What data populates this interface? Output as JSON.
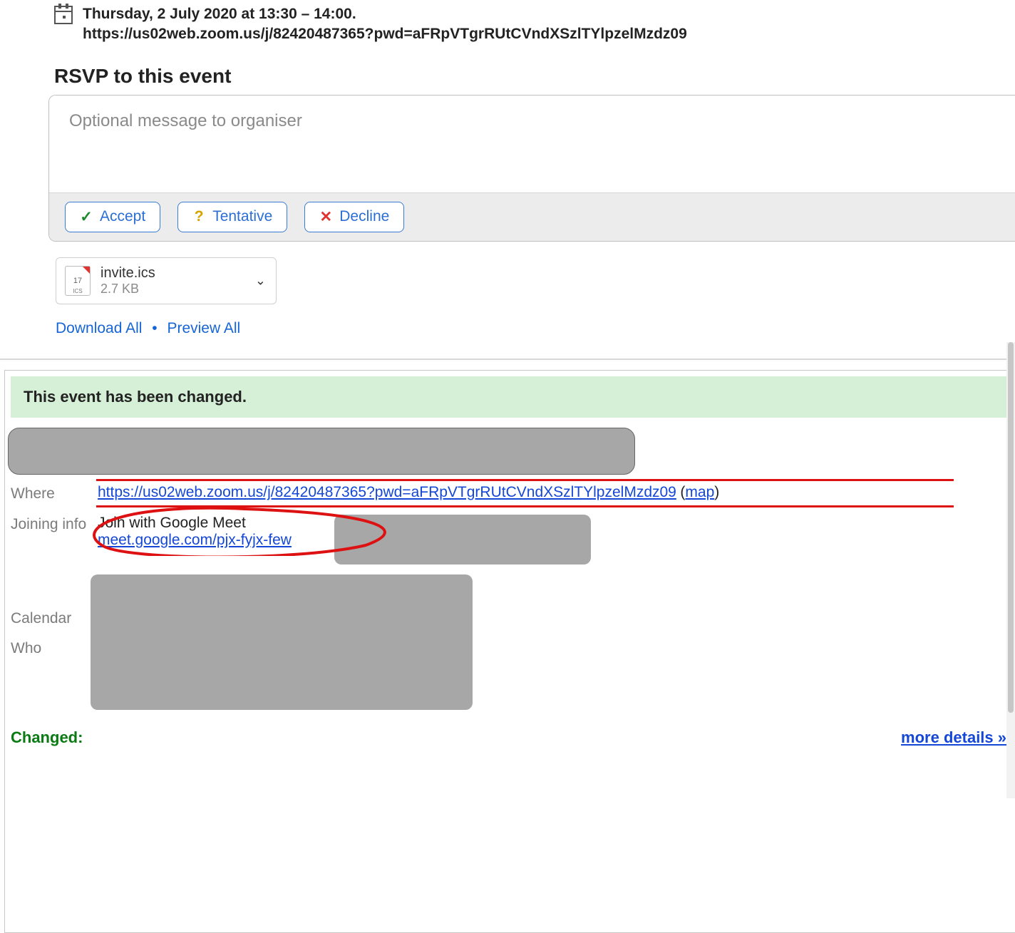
{
  "header": {
    "date_line": "Thursday, 2 July 2020 at 13:30 – 14:00.",
    "url_line": "https://us02web.zoom.us/j/82420487365?pwd=aFRpVTgrRUtCVndXSzlTYlpzelMzdz09"
  },
  "rsvp": {
    "title": "RSVP to this event",
    "placeholder": "Optional message to organiser",
    "accept": "Accept",
    "tentative": "Tentative",
    "decline": "Decline"
  },
  "attachment": {
    "filename": "invite.ics",
    "size": "2.7 KB",
    "icon_day": "17",
    "icon_tag": "ICS"
  },
  "links": {
    "download_all": "Download All",
    "preview_all": "Preview All"
  },
  "event": {
    "changed_banner": "This event has been changed.",
    "where_label": "Where",
    "where_url": "https://us02web.zoom.us/j/82420487365?pwd=aFRpVTgrRUtCVndXSzlTYlpzelMzdz09",
    "map_label": "map",
    "joining_label": "Joining info",
    "join_with": "Join with Google Meet",
    "meet_url": "meet.google.com/pjx-fyjx-few",
    "calendar_label": "Calendar",
    "who_label": "Who",
    "changed_label": "Changed:",
    "more_details": "more details »"
  }
}
